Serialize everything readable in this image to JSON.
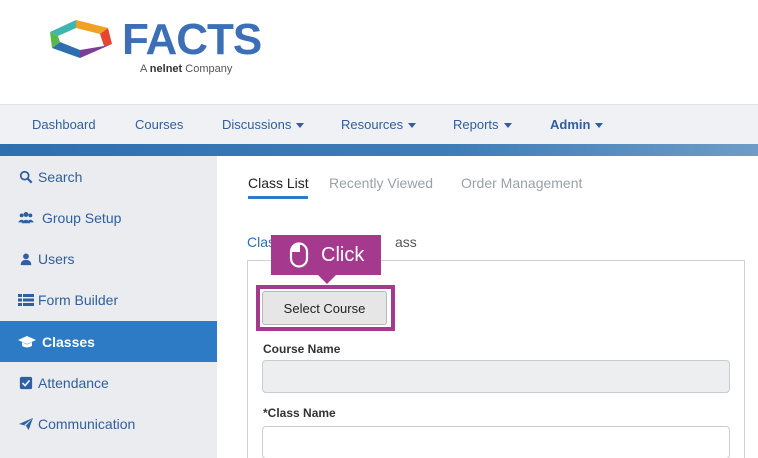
{
  "logo": {
    "brand": "FACTS",
    "sub_prefix": "A",
    "sub_brand": "nelnet",
    "sub_suffix": "Company"
  },
  "topnav": {
    "items": [
      {
        "label": "Dashboard",
        "has_caret": false
      },
      {
        "label": "Courses",
        "has_caret": false
      },
      {
        "label": "Discussions",
        "has_caret": true
      },
      {
        "label": "Resources",
        "has_caret": true
      },
      {
        "label": "Reports",
        "has_caret": true
      },
      {
        "label": "Admin",
        "has_caret": true
      }
    ]
  },
  "sidebar": {
    "items": [
      {
        "label": "Search",
        "icon": "search-icon"
      },
      {
        "label": "Group Setup",
        "icon": "group-icon"
      },
      {
        "label": "Users",
        "icon": "user-icon"
      },
      {
        "label": "Form Builder",
        "icon": "list-icon"
      },
      {
        "label": "Classes",
        "icon": "graduation-cap-icon",
        "active": true
      },
      {
        "label": "Attendance",
        "icon": "checkbox-icon"
      },
      {
        "label": "Communication",
        "icon": "paper-plane-icon"
      }
    ]
  },
  "tabs": [
    {
      "label": "Class List",
      "active": true
    },
    {
      "label": "Recently Viewed",
      "active": false
    },
    {
      "label": "Order Management",
      "active": false
    }
  ],
  "breadcrumb": {
    "link": "Clas",
    "rest": "ass"
  },
  "form": {
    "select_course_label": "Select Course",
    "course_name_label": "Course Name",
    "course_name_value": "",
    "class_name_label": "*Class Name",
    "class_name_value": ""
  },
  "tooltip": {
    "label": "Click",
    "icon": "mouse-icon"
  },
  "colors": {
    "accent": "#2c7bc4",
    "highlight": "#a4398d",
    "link": "#2f5f9e"
  }
}
